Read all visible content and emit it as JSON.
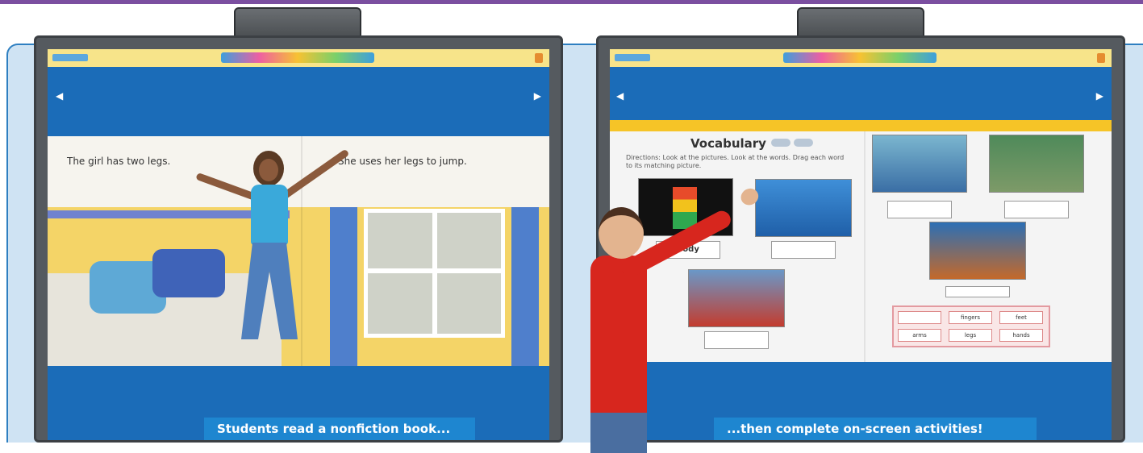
{
  "captions": {
    "left": "Students read a nonfiction book...",
    "right": "...then complete on-screen activities!"
  },
  "left_book": {
    "page1_text": "The girl has two legs.",
    "page2_text": "She uses her legs to jump."
  },
  "right_book": {
    "title": "Vocabulary",
    "directions": "Directions: Look at the pictures. Look at the words. Drag each word to its matching picture.",
    "labels": [
      "body",
      "",
      "",
      "",
      "",
      "",
      ""
    ],
    "word_bank": [
      "",
      "fingers",
      "feet",
      "arms",
      "legs",
      "hands"
    ]
  },
  "nav": {
    "prev": "◀",
    "next": "▶"
  },
  "colors": {
    "screen_blue": "#1b6cb8",
    "caption_blue": "#1e86d0",
    "accent_yellow": "#f6c427"
  }
}
